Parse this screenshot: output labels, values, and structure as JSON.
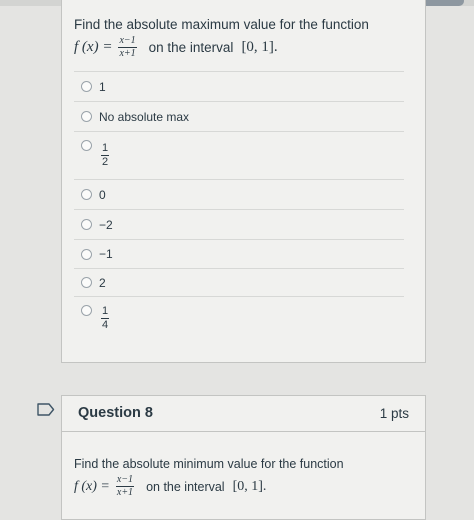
{
  "question7": {
    "prompt": "Find the absolute maximum value for the function",
    "func_lhs": "f (x) =",
    "func_num": "x−1",
    "func_den": "x+1",
    "interval_text": "on the interval",
    "interval": "[0, 1]."
  },
  "answers": [
    {
      "label": "1"
    },
    {
      "label": "No absolute max"
    },
    {
      "num": "1",
      "den": "2"
    },
    {
      "label": "0"
    },
    {
      "label": "−2"
    },
    {
      "label": "−1"
    },
    {
      "label": "2"
    },
    {
      "num": "1",
      "den": "4"
    }
  ],
  "question8": {
    "title": "Question 8",
    "points": "1 pts",
    "prompt": "Find the absolute minimum value for the function",
    "func_lhs": "f (x) =",
    "func_num": "x−1",
    "func_den": "x+1",
    "interval_text": "on the interval",
    "interval": "[0, 1]."
  },
  "icons": {
    "bookmark": "bookmark-icon",
    "radio": "radio-button"
  }
}
